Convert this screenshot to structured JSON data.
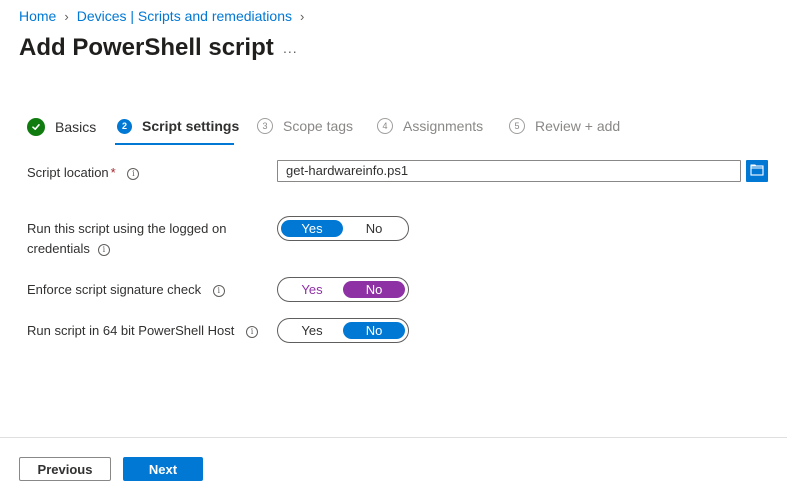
{
  "breadcrumb": {
    "items": [
      "Home",
      "Devices | Scripts and remediations"
    ]
  },
  "page": {
    "title": "Add PowerShell script",
    "more_label": "..."
  },
  "wizard": {
    "steps": [
      {
        "number": "",
        "label": "Basics",
        "state": "complete"
      },
      {
        "number": "2",
        "label": "Script settings",
        "state": "current"
      },
      {
        "number": "3",
        "label": "Scope tags",
        "state": "pending"
      },
      {
        "number": "4",
        "label": "Assignments",
        "state": "pending"
      },
      {
        "number": "5",
        "label": "Review + add",
        "state": "pending"
      }
    ]
  },
  "form": {
    "script_location": {
      "label": "Script location",
      "required_mark": "*",
      "value": "get-hardwareinfo.ps1"
    },
    "run_as_logged_on": {
      "label_line1": "Run this script using the logged on",
      "label_line2": "credentials",
      "yes": "Yes",
      "no": "No",
      "selected": "Yes"
    },
    "enforce_signature": {
      "label": "Enforce script signature check",
      "yes": "Yes",
      "no": "No",
      "selected": "No"
    },
    "run_64bit": {
      "label": "Run script in 64 bit PowerShell Host",
      "yes": "Yes",
      "no": "No",
      "selected": "No"
    },
    "info_glyph": "i"
  },
  "footer": {
    "previous_label": "Previous",
    "next_label": "Next"
  },
  "colors": {
    "accent": "#0078d4",
    "complete": "#107c10",
    "purple": "#8e31a5",
    "required": "#a4262c"
  }
}
